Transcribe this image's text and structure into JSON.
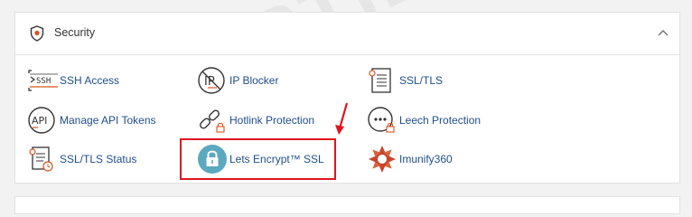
{
  "section": {
    "title": "Security",
    "items": [
      {
        "label": "SSH Access",
        "icon": "ssh-terminal-icon"
      },
      {
        "label": "IP Blocker",
        "icon": "ip-blocker-icon"
      },
      {
        "label": "SSL/TLS",
        "icon": "ssl-tls-certificate-icon"
      },
      {
        "label": "Manage API Tokens",
        "icon": "api-tokens-icon"
      },
      {
        "label": "Hotlink Protection",
        "icon": "hotlink-protection-icon"
      },
      {
        "label": "Leech Protection",
        "icon": "leech-protection-icon"
      },
      {
        "label": "SSL/TLS Status",
        "icon": "ssl-tls-status-icon"
      },
      {
        "label": "Lets Encrypt™ SSL",
        "icon": "lets-encrypt-lock-icon"
      },
      {
        "label": "Imunify360",
        "icon": "imunify360-icon"
      }
    ]
  },
  "watermark": "HOSTIDER",
  "colors": {
    "link": "#1f4e8c",
    "highlight": "#e0141e",
    "lets_encrypt_teal": "#5aa9bf",
    "imunify_red": "#c8452f"
  }
}
